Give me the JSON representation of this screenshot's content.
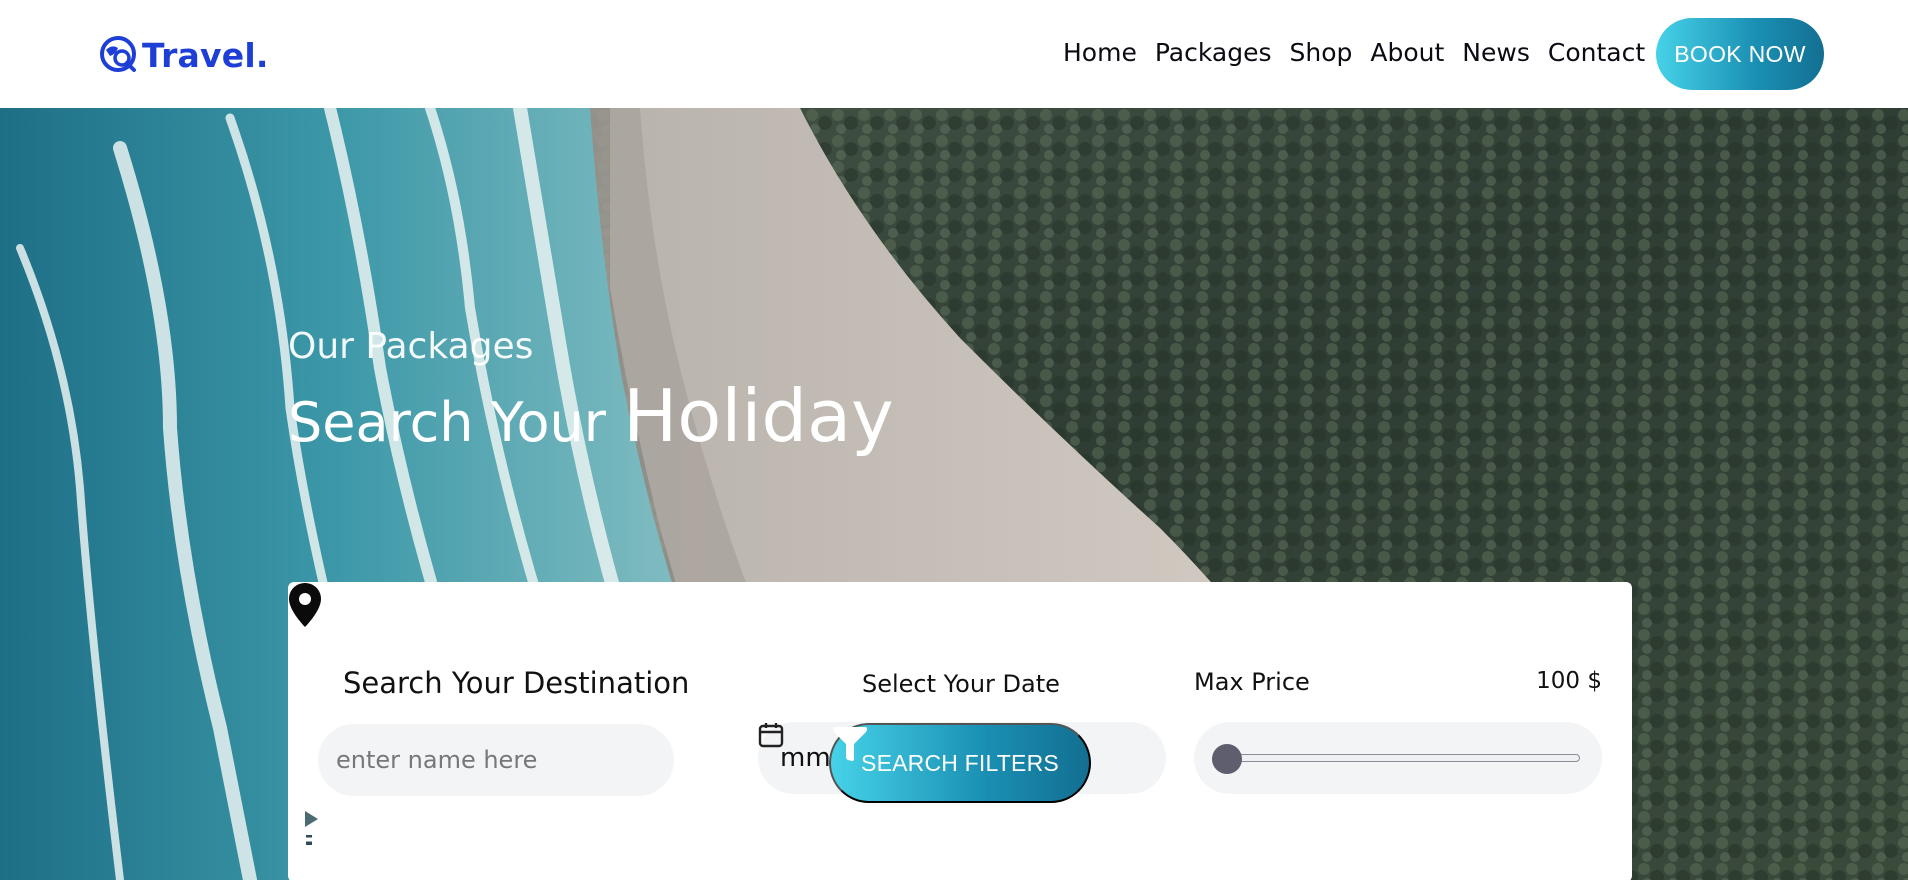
{
  "header": {
    "logo_text": "Travel.",
    "nav": [
      "Home",
      "Packages",
      "Shop",
      "About",
      "News",
      "Contact"
    ],
    "book_label": "BOOK NOW"
  },
  "hero": {
    "subtitle": "Our Packages",
    "title_part1": "Search Your ",
    "title_part2": "Holiday"
  },
  "search": {
    "destination_label": "Search Your Destination",
    "destination_placeholder": "enter name here",
    "date_label": "Select Your Date",
    "date_value": "mm / dd / yyyy",
    "price_label": "Max Price",
    "price_value": "100 $",
    "slider_value": 0,
    "filter_label": "SEARCH FILTERS"
  },
  "social": [
    "facebook-icon",
    "instagram-icon",
    "youtube-icon"
  ],
  "colors": {
    "brand": "#1d3fd6",
    "accent_start": "#46d2e8",
    "accent_end": "#136f91"
  }
}
